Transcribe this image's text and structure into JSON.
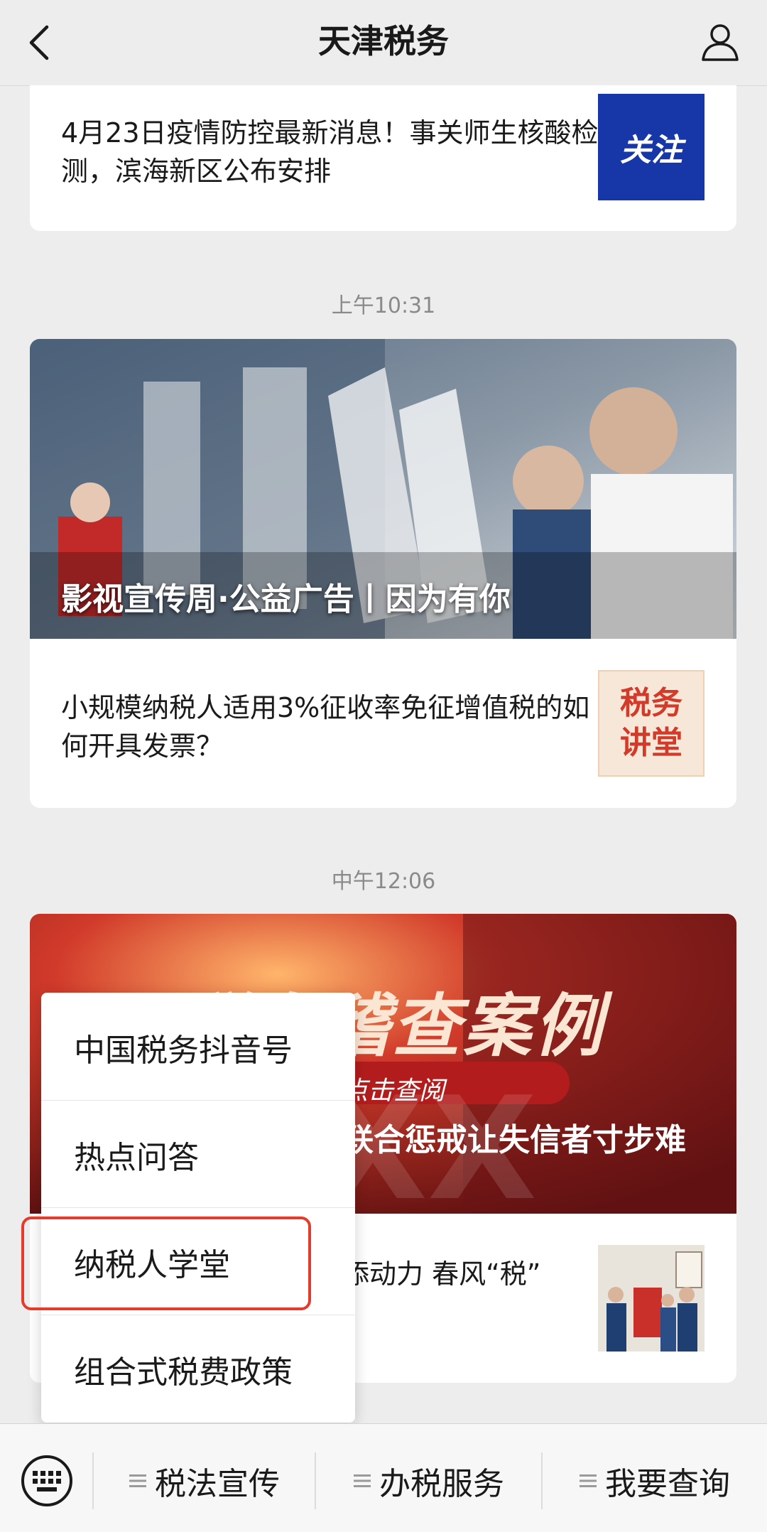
{
  "header": {
    "title": "天津税务"
  },
  "articles": {
    "top_item": {
      "text": "4月23日疫情防控最新消息！事关师生核酸检测，滨海新区公布安排",
      "thumb_label": "关注"
    },
    "group2": {
      "time": "上午10:31",
      "hero_caption": "影视宣传周·公益广告丨因为有你",
      "item_text": "小规模纳税人适用3%征收率免征增值税的如何开具发票？",
      "thumb_label": "税务讲堂"
    },
    "group3": {
      "time": "中午12:06",
      "hero_title": "税务稽查案例",
      "hero_banner": "点击查阅",
      "hero_subtitle": "联合惩戒让失信者寸步难",
      "item_text_partial": "添动力 春风“税”"
    }
  },
  "popup_menu": {
    "items": [
      "中国税务抖音号",
      "热点问答",
      "纳税人学堂",
      "组合式税费政策"
    ],
    "highlighted_index": 2
  },
  "bottom_menu": {
    "tabs": [
      "税法宣传",
      "办税服务",
      "我要查询"
    ]
  },
  "colors": {
    "highlight": "#e53b2c",
    "background": "#ededed"
  }
}
